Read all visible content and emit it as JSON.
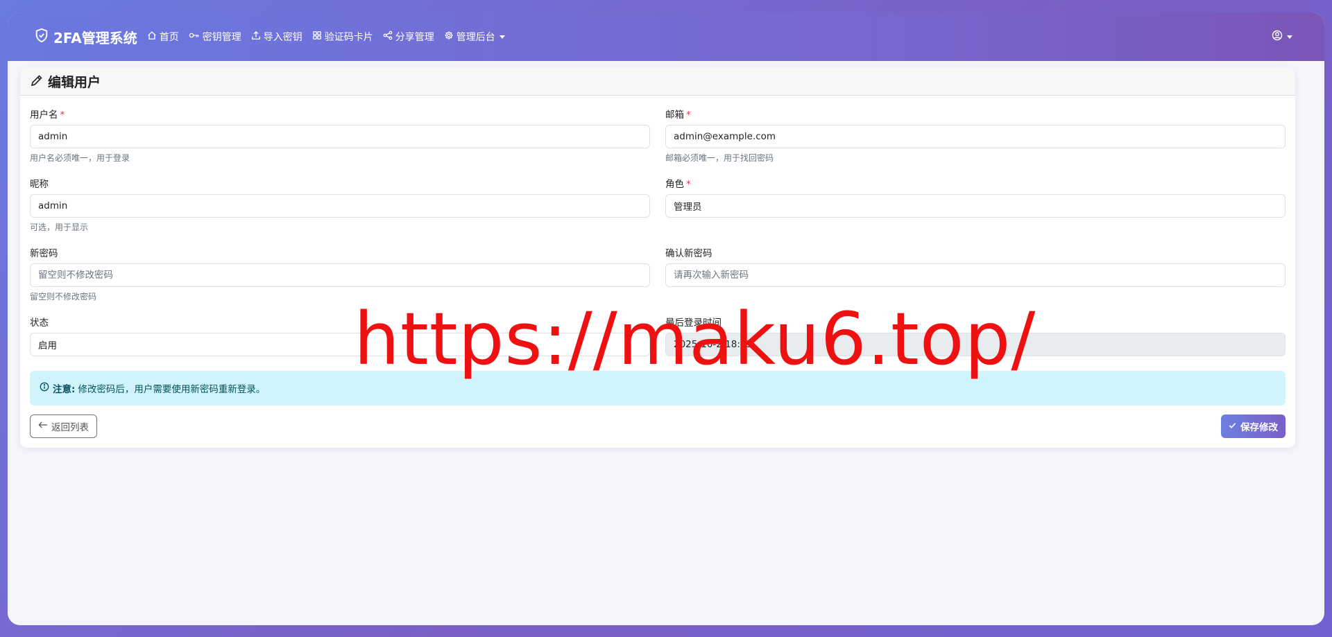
{
  "navbar": {
    "brand": "2FA管理系统",
    "items": [
      {
        "label": "首页",
        "icon": "home-icon"
      },
      {
        "label": "密钥管理",
        "icon": "key-icon"
      },
      {
        "label": "导入密钥",
        "icon": "upload-icon"
      },
      {
        "label": "验证码卡片",
        "icon": "grid-icon"
      },
      {
        "label": "分享管理",
        "icon": "share-icon"
      },
      {
        "label": "管理后台",
        "icon": "gear-icon"
      }
    ],
    "user_icon": "user-circle-icon"
  },
  "card": {
    "title": "编辑用户"
  },
  "form": {
    "username": {
      "label": "用户名",
      "value": "admin",
      "hint": "用户名必须唯一，用于登录",
      "required": "*"
    },
    "email": {
      "label": "邮箱",
      "value": "admin@example.com",
      "hint": "邮箱必须唯一，用于找回密码",
      "required": "*"
    },
    "nickname": {
      "label": "昵称",
      "value": "admin",
      "hint": "可选，用于显示"
    },
    "role": {
      "label": "角色",
      "value": "管理员",
      "required": "*"
    },
    "new_password": {
      "label": "新密码",
      "placeholder": "留空则不修改密码",
      "hint": "留空则不修改密码"
    },
    "confirm_password": {
      "label": "确认新密码",
      "placeholder": "请再次输入新密码"
    },
    "status": {
      "label": "状态",
      "value": "启用"
    },
    "last_login": {
      "label": "最后登录时间",
      "value": "2025-10-2 18:33"
    }
  },
  "alert": {
    "title": "注意:",
    "text": "修改密码后，用户需要使用新密码重新登录。"
  },
  "buttons": {
    "back": "返回列表",
    "save": "保存修改"
  },
  "watermark": "https://maku6.top/"
}
